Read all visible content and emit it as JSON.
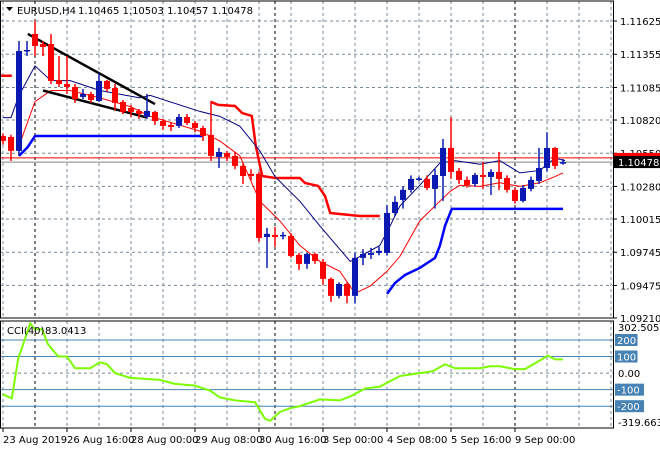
{
  "header": {
    "symbol_tf": "EURUSD,H4",
    "ohlc": "1.10465 1.10503 1.10457 1.10478"
  },
  "colors": {
    "bull": "#0a1ab0",
    "bear": "#ff0000",
    "grid": "#778899",
    "cci": "#7cfc00",
    "level": "#4682b4"
  },
  "chart_data": [
    {
      "type": "candlestick",
      "title": "EURUSD,H4",
      "ylim": [
        1.0921,
        1.11788
      ],
      "price_ticks": [
        "1.11625",
        "1.11355",
        "1.11085",
        "1.10820",
        "1.10550",
        "1.10280",
        "1.10015",
        "1.09745",
        "1.09475",
        "1.09210"
      ],
      "time_ticks": [
        {
          "index": 0,
          "label": "23 Aug 2019"
        },
        {
          "index": 8,
          "label": "26 Aug 16:00"
        },
        {
          "index": 16,
          "label": "28 Aug 00:00"
        },
        {
          "index": 24,
          "label": "29 Aug 08:00"
        },
        {
          "index": 32,
          "label": "30 Aug 16:00"
        },
        {
          "index": 40,
          "label": "3 Sep 00:00"
        },
        {
          "index": 48,
          "label": "4 Sep 08:00"
        },
        {
          "index": 56,
          "label": "5 Sep 16:00"
        },
        {
          "index": 64,
          "label": "9 Sep 00:00"
        }
      ],
      "week_separators": [
        4,
        34,
        64
      ],
      "bid_price": 1.10478,
      "bid_label": "1.10478",
      "ask_price": 1.10512,
      "candles_ohlc": [
        [
          1.1069,
          1.1071,
          1.1062,
          1.1065
        ],
        [
          1.10682,
          1.107,
          1.10487,
          1.10569
        ],
        [
          1.10569,
          1.11463,
          1.10528,
          1.11381
        ],
        [
          1.11381,
          1.11463,
          1.11341,
          1.1139
        ],
        [
          1.1152,
          1.11625,
          1.11341,
          1.11422
        ],
        [
          1.11438,
          1.11463,
          1.11341,
          1.11414
        ],
        [
          1.11438,
          1.1152,
          1.11113,
          1.11138
        ],
        [
          1.11146,
          1.11341,
          1.11089,
          1.11113
        ],
        [
          1.11113,
          1.11341,
          1.11032,
          1.11089
        ],
        [
          1.11089,
          1.11113,
          1.10959,
          1.10991
        ],
        [
          1.11008,
          1.11073,
          1.10991,
          1.11032
        ],
        [
          1.11032,
          1.1105,
          1.10959,
          1.10983
        ],
        [
          1.10975,
          1.112,
          1.10967,
          1.11138
        ],
        [
          1.11138,
          1.11146,
          1.1105,
          1.11073
        ],
        [
          1.1108,
          1.11113,
          1.10894,
          1.10959
        ],
        [
          1.10967,
          1.10983,
          1.10869,
          1.10886
        ],
        [
          1.10918,
          1.1094,
          1.10845,
          1.10886
        ],
        [
          1.10894,
          1.1091,
          1.1083,
          1.10869
        ],
        [
          1.10845,
          1.11032,
          1.1083,
          1.10894
        ],
        [
          1.10886,
          1.10894,
          1.1078,
          1.10812
        ],
        [
          1.10812,
          1.1083,
          1.1074,
          1.10772
        ],
        [
          1.1078,
          1.108,
          1.1073,
          1.10764
        ],
        [
          1.10772,
          1.10869,
          1.10755,
          1.10845
        ],
        [
          1.10845,
          1.10869,
          1.1078,
          1.10796
        ],
        [
          1.10796,
          1.10812,
          1.1072,
          1.10755
        ],
        [
          1.10755,
          1.10772,
          1.1065,
          1.1069
        ],
        [
          1.10699,
          1.10975,
          1.10487,
          1.10528
        ],
        [
          1.1052,
          1.10593,
          1.1043,
          1.1056
        ],
        [
          1.10552,
          1.10569,
          1.10487,
          1.1052
        ],
        [
          1.10528,
          1.1056,
          1.1042,
          1.10447
        ],
        [
          1.10447,
          1.1047,
          1.103,
          1.10365
        ],
        [
          1.10382,
          1.1042,
          1.1033,
          1.10365
        ],
        [
          1.10382,
          1.10398,
          1.0983,
          1.09861
        ],
        [
          1.09869,
          1.09943,
          1.09617,
          1.09894
        ],
        [
          1.09886,
          1.0995,
          1.0979,
          1.09869
        ],
        [
          1.09878,
          1.0991,
          1.0985,
          1.09886
        ],
        [
          1.09878,
          1.099,
          1.097,
          1.09715
        ],
        [
          1.09723,
          1.0974,
          1.096,
          1.0965
        ],
        [
          1.0965,
          1.0974,
          1.0961,
          1.09731
        ],
        [
          1.09731,
          1.0974,
          1.0965,
          1.09674
        ],
        [
          1.09666,
          1.0969,
          1.0948,
          1.09528
        ],
        [
          1.09528,
          1.0954,
          1.0934,
          1.0939
        ],
        [
          1.0939,
          1.095,
          1.0937,
          1.09487
        ],
        [
          1.09487,
          1.095,
          1.0933,
          1.0939
        ],
        [
          1.0939,
          1.0974,
          1.0933,
          1.09699
        ],
        [
          1.09699,
          1.0977,
          1.0964,
          1.09731
        ],
        [
          1.09723,
          1.0978,
          1.0969,
          1.09739
        ],
        [
          1.09739,
          1.0979,
          1.0972,
          1.09756
        ],
        [
          1.09739,
          1.1013,
          1.0972,
          1.10064
        ],
        [
          1.10064,
          1.102,
          1.1004,
          1.10154
        ],
        [
          1.1017,
          1.1028,
          1.101,
          1.10252
        ],
        [
          1.10252,
          1.1037,
          1.1023,
          1.10341
        ],
        [
          1.10341,
          1.1036,
          1.10325,
          1.10345
        ],
        [
          1.10341,
          1.1037,
          1.1025,
          1.10268
        ],
        [
          1.1026,
          1.1042,
          1.101,
          1.10373
        ],
        [
          1.10365,
          1.10666,
          1.10162,
          1.10593
        ],
        [
          1.10593,
          1.10845,
          1.10341,
          1.10398
        ],
        [
          1.10406,
          1.1043,
          1.103,
          1.10333
        ],
        [
          1.10333,
          1.1036,
          1.1027,
          1.10292
        ],
        [
          1.103,
          1.1039,
          1.1028,
          1.10373
        ],
        [
          1.10373,
          1.1048,
          1.1026,
          1.10357
        ],
        [
          1.10357,
          1.1042,
          1.1021,
          1.10398
        ],
        [
          1.10398,
          1.1056,
          1.1025,
          1.10341
        ],
        [
          1.10349,
          1.1037,
          1.1023,
          1.10252
        ],
        [
          1.10252,
          1.1027,
          1.1014,
          1.10162
        ],
        [
          1.10162,
          1.1029,
          1.1015,
          1.10268
        ],
        [
          1.1026,
          1.1036,
          1.1024,
          1.10333
        ],
        [
          1.10325,
          1.10593,
          1.103,
          1.1043
        ],
        [
          1.1043,
          1.1072,
          1.104,
          1.10593
        ],
        [
          1.10593,
          1.106,
          1.1042,
          1.10447
        ],
        [
          1.10465,
          1.10503,
          1.10457,
          1.10478
        ]
      ],
      "overlays": [
        {
          "name": "upper-band-early",
          "color": "#ff0000",
          "width": 2.5,
          "points": [
            [
              -0.4,
              1.1118
            ],
            [
              1.1,
              1.1118
            ]
          ]
        },
        {
          "name": "upper-band",
          "color": "#ff0000",
          "width": 2.5,
          "points": [
            [
              26,
              1.10967
            ],
            [
              26.9,
              1.10943
            ],
            [
              29,
              1.10934
            ],
            [
              29.9,
              1.10877
            ],
            [
              31.1,
              1.10853
            ],
            [
              31.6,
              1.10609
            ],
            [
              32.4,
              1.10365
            ],
            [
              34,
              1.10349
            ],
            [
              37.1,
              1.10349
            ],
            [
              37.75,
              1.10308
            ],
            [
              39.4,
              1.10284
            ],
            [
              40.25,
              1.10203
            ],
            [
              40.9,
              1.10064
            ],
            [
              42.1,
              1.10056
            ],
            [
              44.6,
              1.1004
            ],
            [
              47.1,
              1.1004
            ]
          ]
        },
        {
          "name": "lower-band",
          "color": "#0000ff",
          "width": 2.5,
          "points": [
            [
              2,
              1.10528
            ],
            [
              3.1,
              1.10601
            ],
            [
              4,
              1.1069
            ],
            [
              25,
              1.1069
            ]
          ]
        },
        {
          "name": "lower-band-late",
          "color": "#0000ff",
          "width": 2.5,
          "points": [
            [
              48,
              1.09406
            ],
            [
              49,
              1.09495
            ],
            [
              50.25,
              1.0956
            ],
            [
              52.1,
              1.09617
            ],
            [
              54,
              1.09699
            ],
            [
              54.6,
              1.09796
            ],
            [
              55.25,
              1.09959
            ],
            [
              56.1,
              1.10097
            ],
            [
              70,
              1.10097
            ]
          ]
        },
        {
          "name": "slow-ma",
          "color": "#000080",
          "width": 1,
          "points": [
            [
              0,
              1.1084
            ],
            [
              1,
              1.1084
            ],
            [
              2,
              1.1102
            ],
            [
              4,
              1.1126
            ],
            [
              6,
              1.1114
            ],
            [
              8.4,
              1.1114
            ],
            [
              12.1,
              1.1106
            ],
            [
              17.1,
              1.11
            ],
            [
              18.4,
              1.1102
            ],
            [
              24.6,
              1.1089
            ],
            [
              27.1,
              1.1085
            ],
            [
              29.6,
              1.1077
            ],
            [
              32.1,
              1.1057
            ],
            [
              34,
              1.1036
            ],
            [
              37.1,
              1.1016
            ],
            [
              39.6,
              1.0996
            ],
            [
              43.4,
              1.0967
            ],
            [
              44.6,
              1.0971
            ],
            [
              47.1,
              1.098
            ],
            [
              48.4,
              1.0996
            ],
            [
              49.6,
              1.1012
            ],
            [
              52.1,
              1.1029
            ],
            [
              54.6,
              1.1047
            ],
            [
              56.5,
              1.1049
            ],
            [
              59.6,
              1.1046
            ],
            [
              62.1,
              1.1049
            ],
            [
              64.6,
              1.1039
            ],
            [
              67.1,
              1.1041
            ],
            [
              69,
              1.1051
            ],
            [
              70.25,
              1.1049
            ]
          ]
        },
        {
          "name": "fast-ma",
          "color": "#ff0000",
          "width": 1,
          "points": [
            [
              2,
              1.1061
            ],
            [
              4,
              1.1097
            ],
            [
              6,
              1.1106
            ],
            [
              8.4,
              1.1106
            ],
            [
              12.1,
              1.11
            ],
            [
              15.9,
              1.1093
            ],
            [
              18.4,
              1.1085
            ],
            [
              24.6,
              1.1073
            ],
            [
              27.1,
              1.1065
            ],
            [
              29.6,
              1.1053
            ],
            [
              32.1,
              1.1016
            ],
            [
              34.6,
              1.1
            ],
            [
              37.1,
              1.098
            ],
            [
              39.6,
              1.0967
            ],
            [
              42.1,
              1.0959
            ],
            [
              44,
              1.0941
            ],
            [
              45.9,
              1.0947
            ],
            [
              48,
              1.0959
            ],
            [
              49.6,
              1.0971
            ],
            [
              52.1,
              1.1
            ],
            [
              54.6,
              1.1016
            ],
            [
              55.9,
              1.1024
            ],
            [
              57.1,
              1.1029
            ],
            [
              59.6,
              1.1028
            ],
            [
              62.1,
              1.1031
            ],
            [
              64.6,
              1.1028
            ],
            [
              67.1,
              1.1031
            ],
            [
              69,
              1.1036
            ],
            [
              70,
              1.1039
            ]
          ]
        },
        {
          "name": "trendline-upper",
          "color": "#000000",
          "width": 2.5,
          "points": [
            [
              3.1,
              1.1152
            ],
            [
              19,
              1.1095
            ]
          ]
        },
        {
          "name": "trendline-lower",
          "color": "#000000",
          "width": 2.5,
          "points": [
            [
              5,
              1.1106
            ],
            [
              18,
              1.1084
            ]
          ]
        }
      ]
    },
    {
      "type": "line",
      "title": "CCI(40) 83.0413",
      "label": "CCI(40)",
      "last_value": "83.0413",
      "ylim": [
        -319.6636,
        302.5056
      ],
      "max_label": "302.5056",
      "min_label": "-319.6636",
      "zero_label": "0.00",
      "levels": [
        200,
        100,
        -100,
        -200
      ],
      "level_labels": [
        "200",
        "100",
        "-100",
        "-200"
      ],
      "points": [
        [
          0,
          -129
        ],
        [
          1.1,
          -153
        ],
        [
          1.9,
          88
        ],
        [
          2.75,
          206
        ],
        [
          3.4,
          300
        ],
        [
          4,
          265
        ],
        [
          4.9,
          265
        ],
        [
          5.6,
          176
        ],
        [
          6.9,
          100
        ],
        [
          8,
          100
        ],
        [
          9,
          29
        ],
        [
          10.9,
          29
        ],
        [
          12.1,
          65
        ],
        [
          13,
          53
        ],
        [
          14,
          0
        ],
        [
          15.9,
          -29
        ],
        [
          17.75,
          -35
        ],
        [
          19.6,
          -41
        ],
        [
          21.5,
          -65
        ],
        [
          24,
          -76
        ],
        [
          25.9,
          -106
        ],
        [
          27.1,
          -147
        ],
        [
          29,
          -165
        ],
        [
          31.5,
          -176
        ],
        [
          32.75,
          -276
        ],
        [
          33.4,
          -288
        ],
        [
          34.6,
          -235
        ],
        [
          35.9,
          -212
        ],
        [
          37.1,
          -200
        ],
        [
          39.6,
          -159
        ],
        [
          42.1,
          -165
        ],
        [
          43.4,
          -141
        ],
        [
          45.25,
          -94
        ],
        [
          47.1,
          -82
        ],
        [
          47.75,
          -65
        ],
        [
          49.6,
          -18
        ],
        [
          52.1,
          0
        ],
        [
          53.75,
          12
        ],
        [
          55.25,
          53
        ],
        [
          56.5,
          29
        ],
        [
          59.6,
          29
        ],
        [
          60.9,
          41
        ],
        [
          62.1,
          41
        ],
        [
          64,
          24
        ],
        [
          65.25,
          24
        ],
        [
          67.1,
          76
        ],
        [
          68.1,
          106
        ],
        [
          69,
          83
        ],
        [
          70,
          83
        ]
      ]
    }
  ]
}
